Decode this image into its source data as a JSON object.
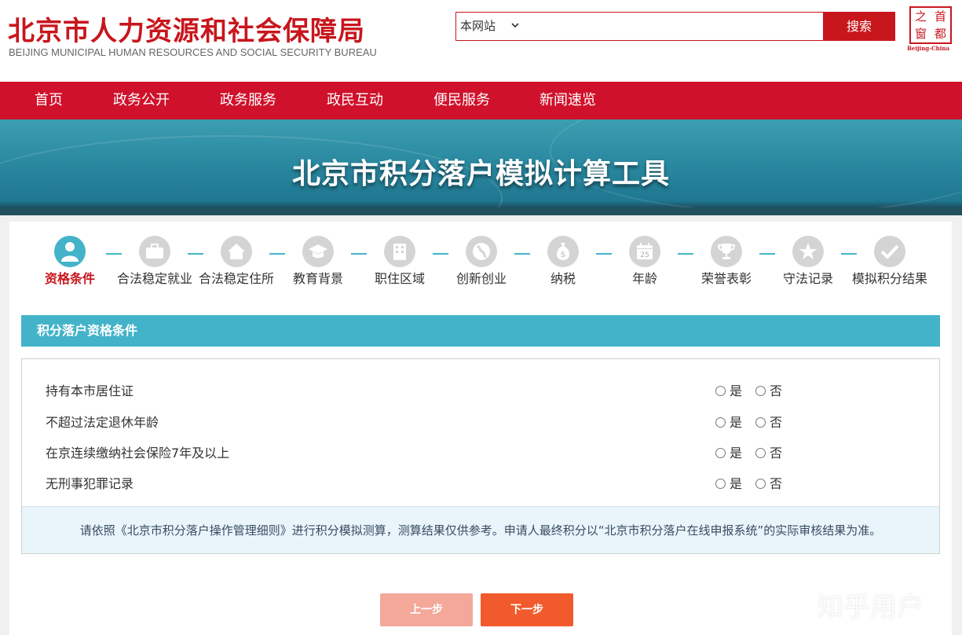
{
  "header": {
    "title": "北京市人力资源和社会保障局",
    "subtitle": "BEIJING MUNICIPAL HUMAN RESOURCES AND SOCIAL SECURITY BUREAU",
    "seal": {
      "chars": [
        "首",
        "都",
        "之",
        "窗"
      ],
      "caption": "Beijing-China"
    }
  },
  "search": {
    "scope": "本网站",
    "value": "",
    "placeholder": "",
    "button_label": "搜索"
  },
  "nav": {
    "items": [
      "首页",
      "政务公开",
      "政务服务",
      "政民互动",
      "便民服务",
      "新闻速览"
    ]
  },
  "banner": {
    "title": "北京市积分落户模拟计算工具"
  },
  "steps": [
    {
      "label": "资格条件",
      "icon": "person-icon",
      "active": true
    },
    {
      "label": "合法稳定就业",
      "icon": "briefcase-icon",
      "active": false
    },
    {
      "label": "合法稳定住所",
      "icon": "house-icon",
      "active": false
    },
    {
      "label": "教育背景",
      "icon": "graduation-cap-icon",
      "active": false
    },
    {
      "label": "职住区域",
      "icon": "building-icon",
      "active": false
    },
    {
      "label": "创新创业",
      "icon": "globe-icon",
      "active": false
    },
    {
      "label": "纳税",
      "icon": "money-bag-icon",
      "active": false
    },
    {
      "label": "年龄",
      "icon": "calendar-icon",
      "active": false
    },
    {
      "label": "荣誉表彰",
      "icon": "trophy-icon",
      "active": false
    },
    {
      "label": "守法记录",
      "icon": "star-icon",
      "active": false
    },
    {
      "label": "模拟积分结果",
      "icon": "check-icon",
      "active": false
    }
  ],
  "calendar_day": "25",
  "section": {
    "title": "积分落户资格条件"
  },
  "questions": [
    {
      "label": "持有本市居住证",
      "yes": "是",
      "no": "否"
    },
    {
      "label": "不超过法定退休年龄",
      "yes": "是",
      "no": "否"
    },
    {
      "label": "在京连续缴纳社会保险7年及以上",
      "yes": "是",
      "no": "否"
    },
    {
      "label": "无刑事犯罪记录",
      "yes": "是",
      "no": "否"
    }
  ],
  "notice": "请依照《北京市积分落户操作管理细则》进行积分模拟测算，测算结果仅供参考。申请人最终积分以“北京市积分落户在线申报系统”的实际审核结果为准。",
  "buttons": {
    "prev": "上一步",
    "next": "下一步"
  },
  "watermark": "知乎用户",
  "colors": {
    "brand_red": "#d0112b",
    "teal": "#43b3c9",
    "next_orange": "#f05a2c",
    "prev_disabled": "#f3a89a"
  }
}
